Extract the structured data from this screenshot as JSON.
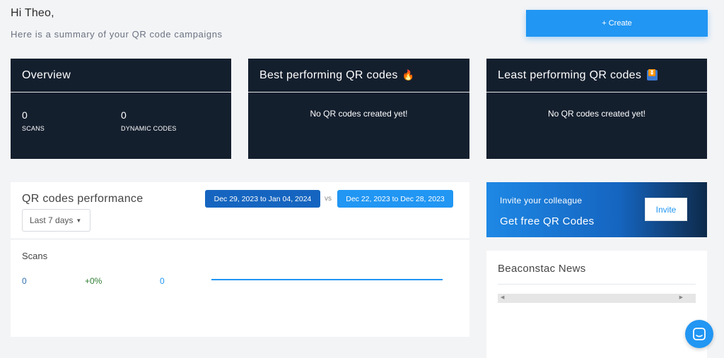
{
  "greeting": {
    "title": "Hi Theo,",
    "subtitle": "Here is a summary of your QR code campaigns"
  },
  "header": {
    "create_label": "+ Create"
  },
  "overview": {
    "title": "Overview",
    "scans_value": "0",
    "scans_label": "SCANS",
    "dynamic_value": "0",
    "dynamic_label": "DYNAMIC CODES"
  },
  "best": {
    "title": "Best performing QR codes",
    "emoji": "🔥",
    "empty": "No QR codes created yet!"
  },
  "least": {
    "title": "Least performing QR codes",
    "empty": "No QR codes created yet!"
  },
  "performance": {
    "title": "QR codes performance",
    "range_selected": "Last 7 days",
    "current_range": "Dec 29, 2023 to Jan 04, 2024",
    "vs": "vs",
    "previous_range": "Dec 22, 2023 to Dec 28, 2023",
    "metric_label": "Scans",
    "current_value": "0",
    "change": "+0%",
    "previous_value": "0"
  },
  "invite": {
    "eyebrow": "Invite your colleague",
    "headline": "Get free QR Codes",
    "button": "Invite"
  },
  "news": {
    "title": "Beaconstac News"
  },
  "colors": {
    "accent": "#2196f3",
    "dark_card": "#141f2e",
    "chip_dark": "#1565c0",
    "positive": "#2e7d32"
  }
}
